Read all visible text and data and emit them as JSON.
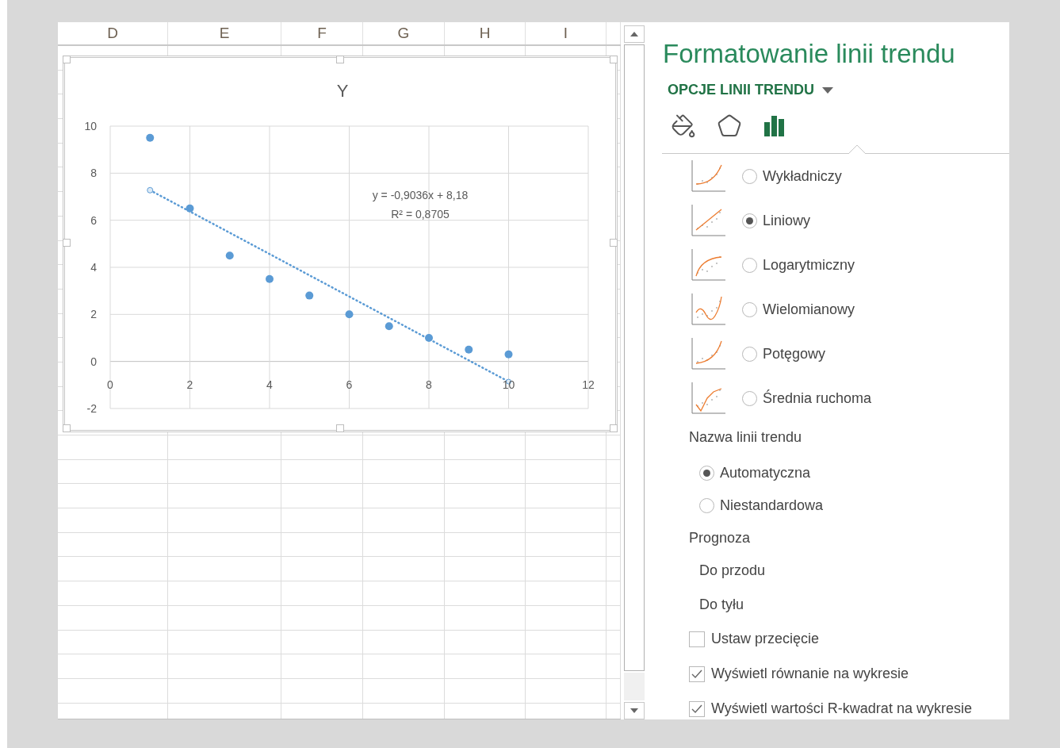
{
  "sheet": {
    "columns": [
      "D",
      "E",
      "F",
      "G",
      "H",
      "I"
    ],
    "chart_data": {
      "type": "scatter",
      "grid": true,
      "x": [
        1,
        2,
        3,
        4,
        5,
        6,
        7,
        8,
        9,
        10
      ],
      "series": [
        {
          "name": "Y",
          "color": "#5b9bd5",
          "values": [
            9.5,
            6.5,
            4.5,
            3.5,
            2.8,
            2,
            1.5,
            1,
            0.5,
            0.3
          ]
        }
      ],
      "xlim": [
        0,
        12
      ],
      "ylim": [
        -2,
        10
      ],
      "xticks": [
        0,
        2,
        4,
        6,
        8,
        10,
        12
      ],
      "yticks": [
        -2,
        0,
        2,
        4,
        6,
        8,
        10
      ],
      "annotations": [
        "y = -0,9036x + 8,18",
        "R² = 0,8705"
      ]
    }
  },
  "panel": {
    "title": "Formatowanie linii trendu",
    "section_menu": "OPCJE LINII TRENDU",
    "tabs": [
      {
        "kind": "fill",
        "selected": false
      },
      {
        "kind": "effects",
        "selected": false
      },
      {
        "kind": "options",
        "selected": true
      }
    ],
    "trend_types": [
      {
        "kind": "exponential",
        "label": "Wykładniczy",
        "selected": false
      },
      {
        "kind": "linear",
        "label": "Liniowy",
        "selected": true
      },
      {
        "kind": "logarithmic",
        "label": "Logarytmiczny",
        "selected": false
      },
      {
        "kind": "polynomial",
        "label": "Wielomianowy",
        "selected": false
      },
      {
        "kind": "power",
        "label": "Potęgowy",
        "selected": false
      },
      {
        "kind": "moving_average",
        "label": "Średnia ruchoma",
        "selected": false
      }
    ],
    "name_label": "Nazwa linii trendu",
    "name_options": [
      {
        "label": "Automatyczna",
        "selected": true
      },
      {
        "label": "Niestandardowa",
        "selected": false
      }
    ],
    "forecast_label": "Prognoza",
    "forecast_fields": [
      "Do przodu",
      "Do tyłu"
    ],
    "checkboxes": [
      {
        "label": "Ustaw przecięcie",
        "checked": false
      },
      {
        "label": "Wyświetl równanie na wykresie",
        "checked": true
      },
      {
        "label": "Wyświetl wartości R-kwadrat na wykresie",
        "checked": true
      }
    ]
  }
}
